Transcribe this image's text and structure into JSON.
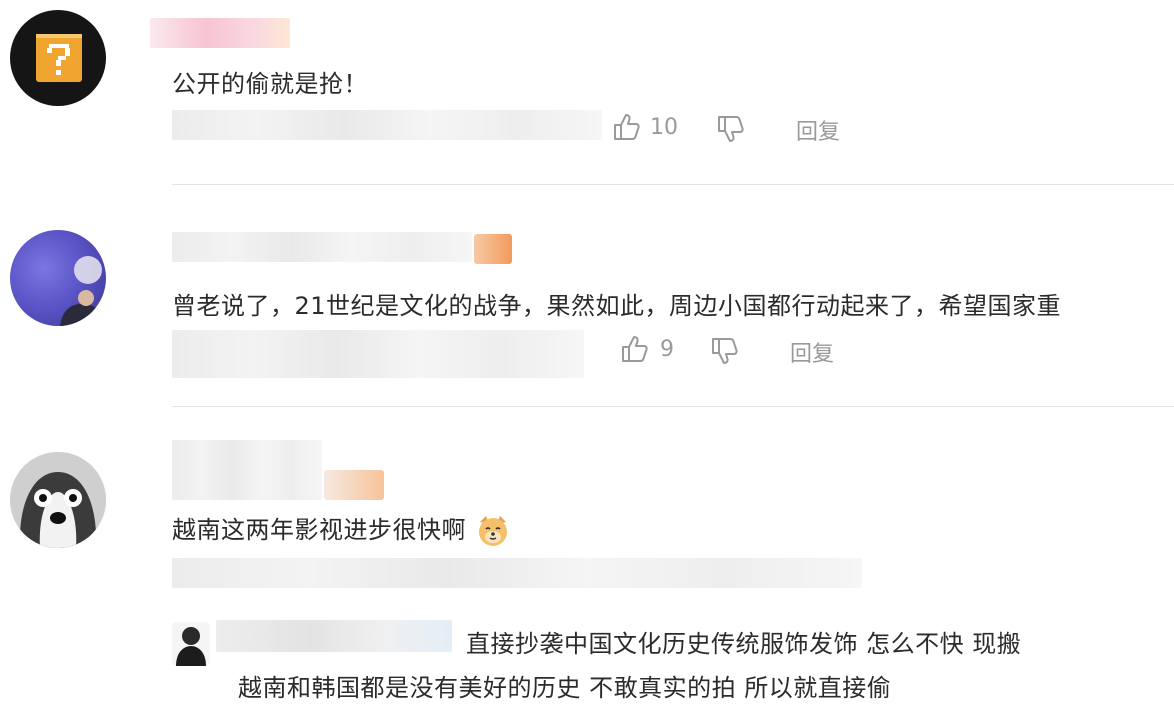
{
  "comments": [
    {
      "text": "公开的偷就是抢！",
      "likes": "10",
      "reply_label": "回复",
      "avatar_icon": "question-block-icon"
    },
    {
      "text": "曾老说了，21世纪是文化的战争，果然如此，周边小国都行动起来了，希望国家重",
      "likes": "9",
      "reply_label": "回复",
      "avatar_icon": "portrait-avatar"
    },
    {
      "text": "越南这两年影视进步很快啊",
      "emoji_icon": "dog-face-emoji-icon",
      "avatar_icon": "husky-avatar"
    }
  ],
  "reply": {
    "line1": "直接抄袭中国文化历史传统服饰发饰 怎么不快 现搬",
    "line2": "越南和韩国都是没有美好的历史 不敢真实的拍 所以就直接偷"
  },
  "colors": {
    "divider": "#e4e4e4",
    "action_gray": "#9a9a9a",
    "text": "#2b2b2b"
  }
}
